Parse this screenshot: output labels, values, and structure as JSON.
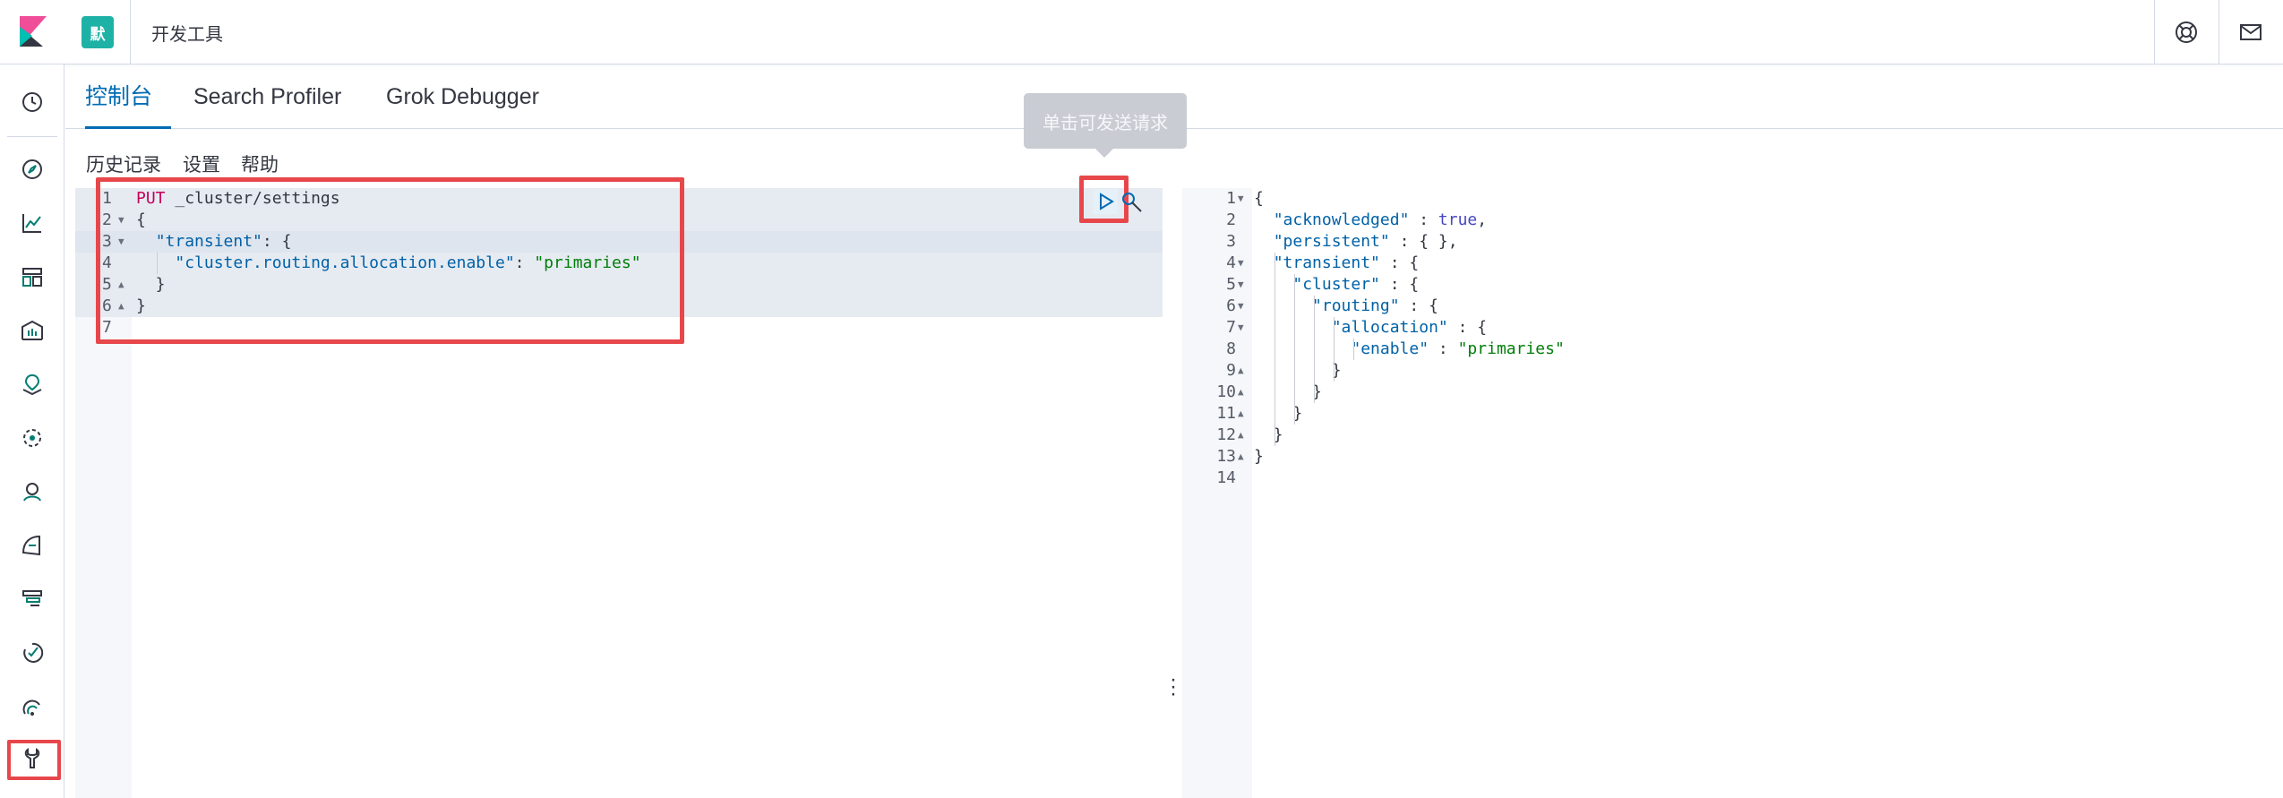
{
  "header": {
    "space_initial": "默",
    "title": "开发工具",
    "help_icon": "help-icon",
    "mail_icon": "mail-icon"
  },
  "sidebar": {
    "items": [
      {
        "icon": "clock-icon"
      },
      {
        "icon": "compass-icon"
      },
      {
        "icon": "visualize-icon"
      },
      {
        "icon": "dashboard-icon"
      },
      {
        "icon": "canvas-icon"
      },
      {
        "icon": "maps-icon"
      },
      {
        "icon": "ml-icon"
      },
      {
        "icon": "infrastructure-icon"
      },
      {
        "icon": "logs-icon"
      },
      {
        "icon": "apm-icon"
      },
      {
        "icon": "uptime-icon"
      },
      {
        "icon": "monitoring-icon"
      },
      {
        "icon": "dev-tools-icon",
        "active": true
      }
    ]
  },
  "tabs": [
    {
      "label": "控制台",
      "active": true
    },
    {
      "label": "Search Profiler"
    },
    {
      "label": "Grok Debugger"
    }
  ],
  "subnav": {
    "history": "历史记录",
    "settings": "设置",
    "help": "帮助"
  },
  "tooltip": "单击可发送请求",
  "request": {
    "lines": [
      {
        "n": "1",
        "method": "PUT",
        "rest": " _cluster/settings"
      },
      {
        "n": "2",
        "text": "{"
      },
      {
        "n": "3",
        "indent": "  ",
        "key": "\"transient\"",
        "rest": ": {"
      },
      {
        "n": "4",
        "indent": "    ",
        "key": "\"cluster.routing.allocation.enable\"",
        "rest": ": ",
        "str": "\"primaries\""
      },
      {
        "n": "5",
        "text": "  }"
      },
      {
        "n": "6",
        "text": "}"
      },
      {
        "n": "7",
        "text": ""
      }
    ]
  },
  "response": {
    "lines": [
      {
        "n": "1",
        "text": "{"
      },
      {
        "n": "2",
        "indent": "  ",
        "key": "\"acknowledged\"",
        "rest": " : ",
        "bool": "true",
        "tail": ","
      },
      {
        "n": "3",
        "indent": "  ",
        "key": "\"persistent\"",
        "rest": " : { },"
      },
      {
        "n": "4",
        "indent": "  ",
        "key": "\"transient\"",
        "rest": " : {"
      },
      {
        "n": "5",
        "indent": "    ",
        "key": "\"cluster\"",
        "rest": " : {"
      },
      {
        "n": "6",
        "indent": "      ",
        "key": "\"routing\"",
        "rest": " : {"
      },
      {
        "n": "7",
        "indent": "        ",
        "key": "\"allocation\"",
        "rest": " : {"
      },
      {
        "n": "8",
        "indent": "          ",
        "key": "\"enable\"",
        "rest": " : ",
        "str": "\"primaries\""
      },
      {
        "n": "9",
        "text": "        }"
      },
      {
        "n": "10",
        "text": "      }"
      },
      {
        "n": "11",
        "text": "    }"
      },
      {
        "n": "12",
        "text": "  }"
      },
      {
        "n": "13",
        "text": "}"
      },
      {
        "n": "14",
        "text": ""
      }
    ]
  },
  "colors": {
    "accent": "#006bb4",
    "highlight_box": "#e7474b",
    "space_badge": "#1eb2a6"
  }
}
